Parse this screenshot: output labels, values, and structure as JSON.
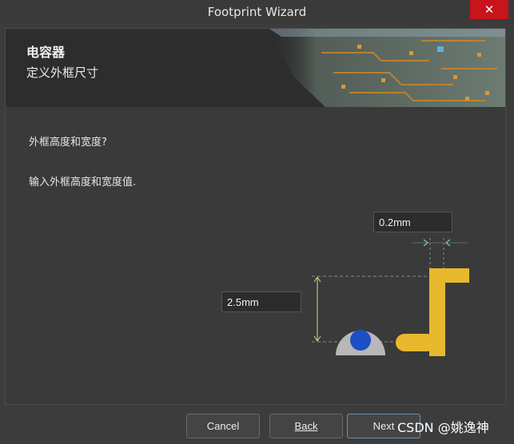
{
  "window": {
    "title": "Footprint Wizard",
    "close_glyph": "✕"
  },
  "header": {
    "title": "电容器",
    "subtitle": "定义外框尺寸"
  },
  "body": {
    "question": "外框高度和宽度?",
    "instruction": "输入外框高度和宽度值."
  },
  "fields": {
    "line_width": "0.2mm",
    "height": "2.5mm"
  },
  "buttons": {
    "cancel": "Cancel",
    "back": "Back",
    "next": "Next"
  },
  "watermark": "CSDN @姚逸神",
  "colors": {
    "accent_pad": "#e8b92d",
    "via_blue": "#1f4fc4",
    "dim_line": "#d9d97a",
    "close_red": "#c8141b"
  }
}
